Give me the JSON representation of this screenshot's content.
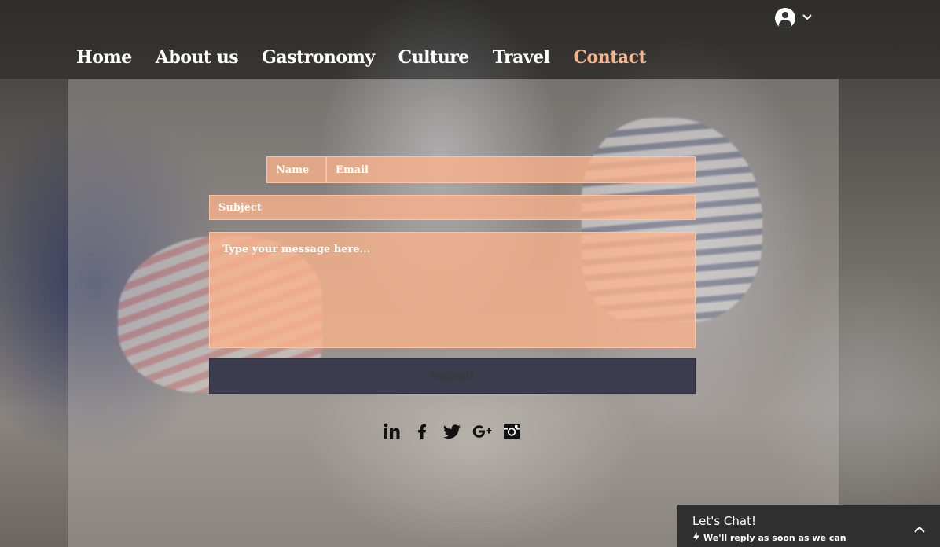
{
  "nav": {
    "items": [
      {
        "label": "Home"
      },
      {
        "label": "About us"
      },
      {
        "label": "Gastronomy"
      },
      {
        "label": "Culture"
      },
      {
        "label": "Travel"
      },
      {
        "label": "Contact"
      }
    ],
    "active_color": "#f7b48b"
  },
  "form": {
    "name_placeholder": "Name",
    "email_placeholder": "Email",
    "subject_placeholder": "Subject",
    "message_placeholder": "Type your message here...",
    "submit_label": "Submit",
    "field_color": "#fbb48c",
    "submit_color": "#3b3c4e"
  },
  "social": {
    "icons": [
      "linkedin-icon",
      "facebook-icon",
      "twitter-icon",
      "google-plus-icon",
      "instagram-icon"
    ]
  },
  "chat": {
    "title": "Let's Chat!",
    "subtitle": "We'll reply as soon as we can"
  }
}
